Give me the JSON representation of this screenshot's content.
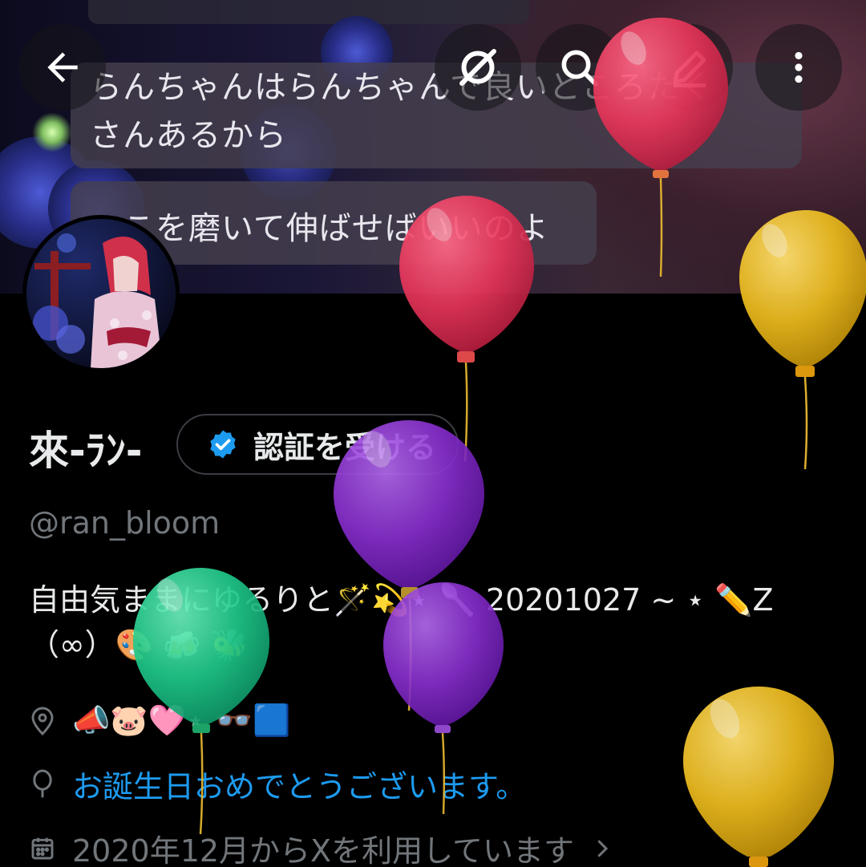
{
  "colors": {
    "accent_blue": "#1d9bf0",
    "muted_gray": "#71767b",
    "balloon_red": "#e8365a",
    "balloon_yellow": "#e8b81e",
    "balloon_purple": "#8a2fd0",
    "balloon_green": "#1fc98a"
  },
  "header": {
    "back_icon": "arrow-left-icon",
    "icons": [
      "grok-icon",
      "search-icon",
      "edit-icon",
      "more-vertical-icon"
    ]
  },
  "banner": {
    "line1": "らんちゃんはらんちゃんで良いところたく",
    "line2": "さんあるから",
    "line3": "ここを磨いて伸ばせばいいのよ"
  },
  "profile": {
    "display_name": "來-ﾗﾝ-",
    "verify_label": "認証を受ける",
    "handle": "@ran_bloom",
    "bio_line1": "自由気ままにゆるりと🪄💫⋆ 🥄 20201027 ~ ⋆ ✏️Z",
    "bio_line2": "（∞）🎨 🍻 🐝",
    "location": "📣🐷🩷⋆ 👓🟦",
    "birthday": "お誕生日おめでとうございます。",
    "joined": "2020年12月からXを利用しています"
  }
}
